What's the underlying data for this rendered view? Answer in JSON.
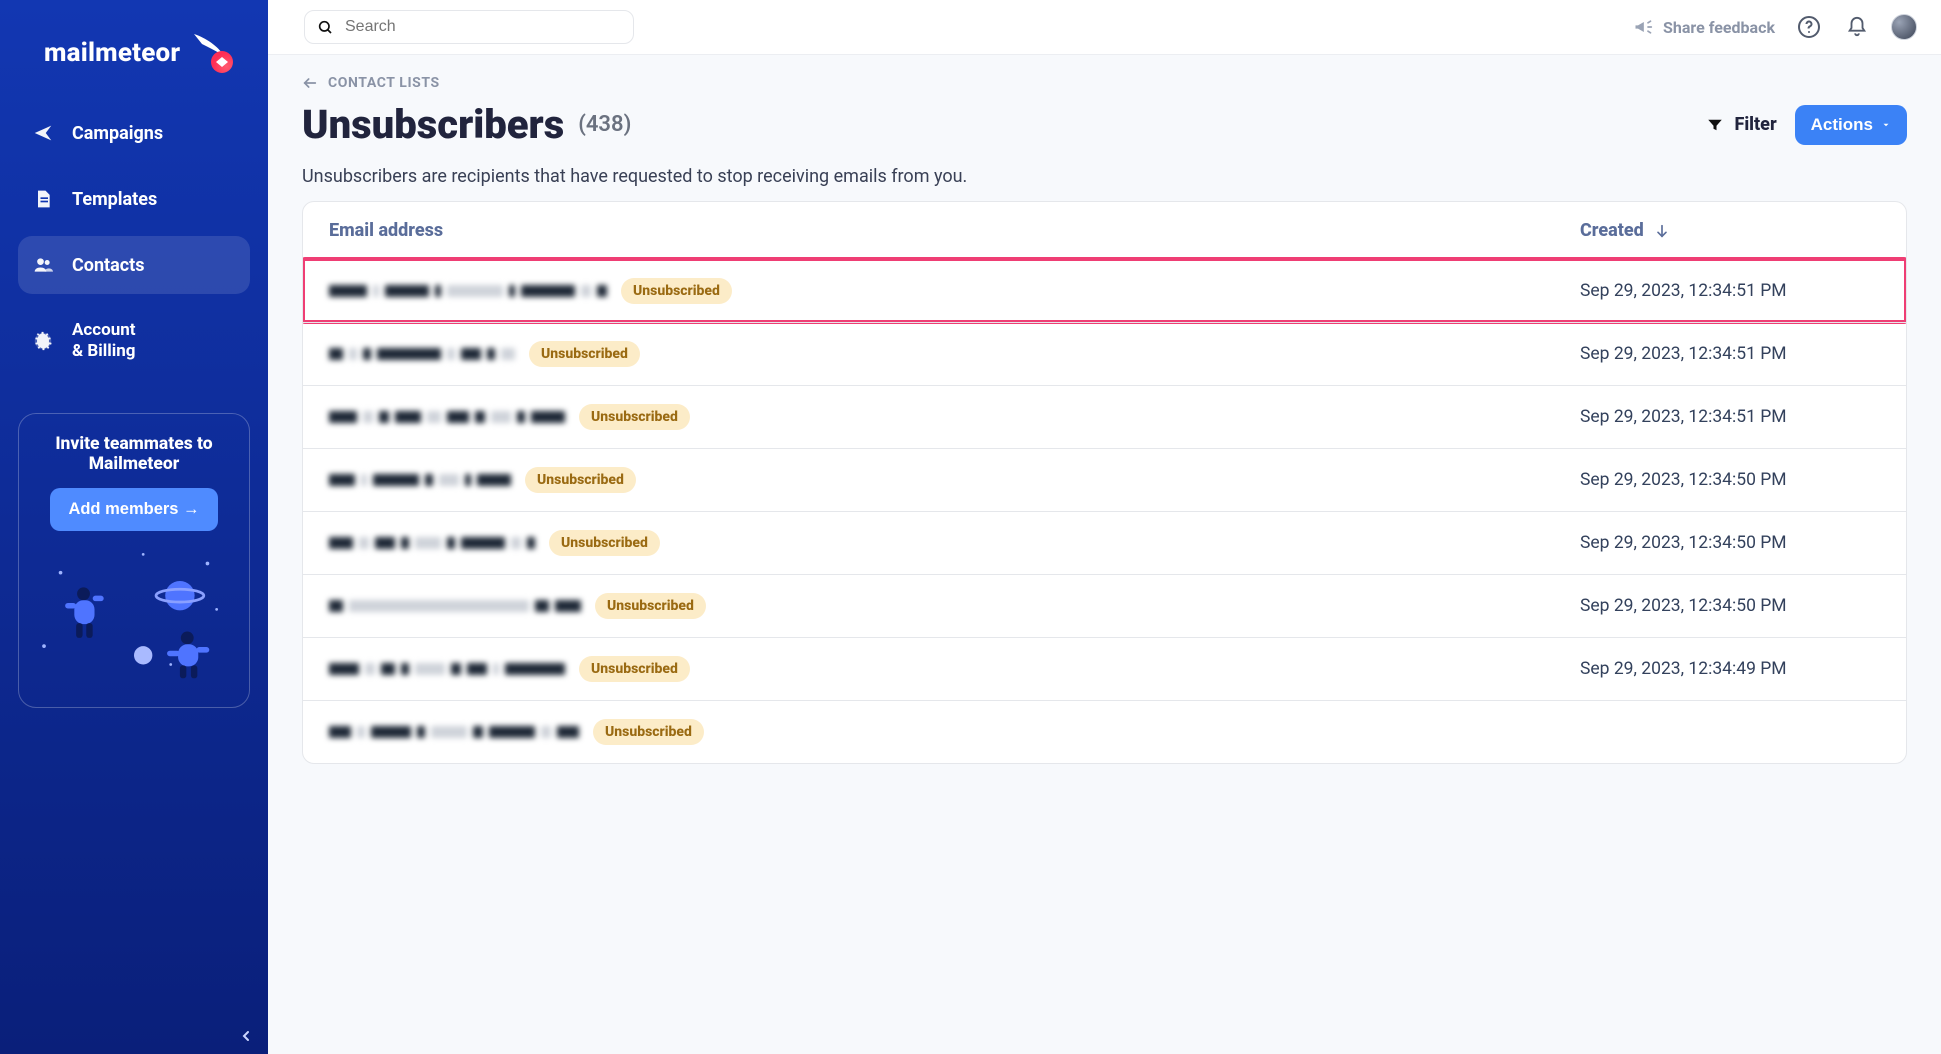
{
  "brand": {
    "name": "mailmeteor"
  },
  "sidebar": {
    "items": [
      {
        "key": "campaigns",
        "label": "Campaigns",
        "active": false
      },
      {
        "key": "templates",
        "label": "Templates",
        "active": false
      },
      {
        "key": "contacts",
        "label": "Contacts",
        "active": true
      },
      {
        "key": "account-billing",
        "label": "Account & Billing",
        "active": false
      }
    ],
    "invite": {
      "title_line1": "Invite teammates to",
      "title_line2": "Mailmeteor",
      "button": "Add members →"
    }
  },
  "topbar": {
    "search_placeholder": "Search",
    "feedback": "Share feedback"
  },
  "breadcrumb": {
    "label": "CONTACT LISTS"
  },
  "page": {
    "title": "Unsubscribers",
    "count_text": "(438)",
    "filter_label": "Filter",
    "actions_label": "Actions",
    "description": "Unsubscribers are recipients that have requested to stop receiving emails from you."
  },
  "table": {
    "columns": {
      "email": "Email address",
      "created": "Created"
    },
    "sort": {
      "column": "created",
      "direction": "desc"
    },
    "badge_label": "Unsubscribed",
    "rows": [
      {
        "highlight": true,
        "created": "Sep 29, 2023, 12:34:51 PM",
        "redaction": [
          38,
          6,
          44,
          6,
          56,
          6,
          54,
          10,
          10
        ]
      },
      {
        "highlight": false,
        "created": "Sep 29, 2023, 12:34:51 PM",
        "redaction": [
          14,
          8,
          8,
          64,
          8,
          20,
          8,
          14
        ]
      },
      {
        "highlight": false,
        "created": "Sep 29, 2023, 12:34:51 PM",
        "redaction": [
          28,
          10,
          10,
          26,
          14,
          22,
          10,
          20,
          8,
          34
        ]
      },
      {
        "highlight": false,
        "created": "Sep 29, 2023, 12:34:50 PM",
        "redaction": [
          26,
          6,
          46,
          8,
          20,
          6,
          34
        ]
      },
      {
        "highlight": false,
        "created": "Sep 29, 2023, 12:34:50 PM",
        "redaction": [
          24,
          10,
          20,
          8,
          26,
          8,
          44,
          10,
          8
        ]
      },
      {
        "highlight": false,
        "created": "Sep 29, 2023, 12:34:50 PM",
        "redaction": [
          14,
          180,
          14,
          26
        ]
      },
      {
        "highlight": false,
        "created": "Sep 29, 2023, 12:34:49 PM",
        "redaction": [
          30,
          10,
          14,
          8,
          30,
          10,
          20,
          6,
          60
        ]
      },
      {
        "highlight": false,
        "created": "",
        "redaction": [
          22,
          8,
          40,
          8,
          36,
          10,
          46,
          10,
          22
        ]
      }
    ]
  }
}
